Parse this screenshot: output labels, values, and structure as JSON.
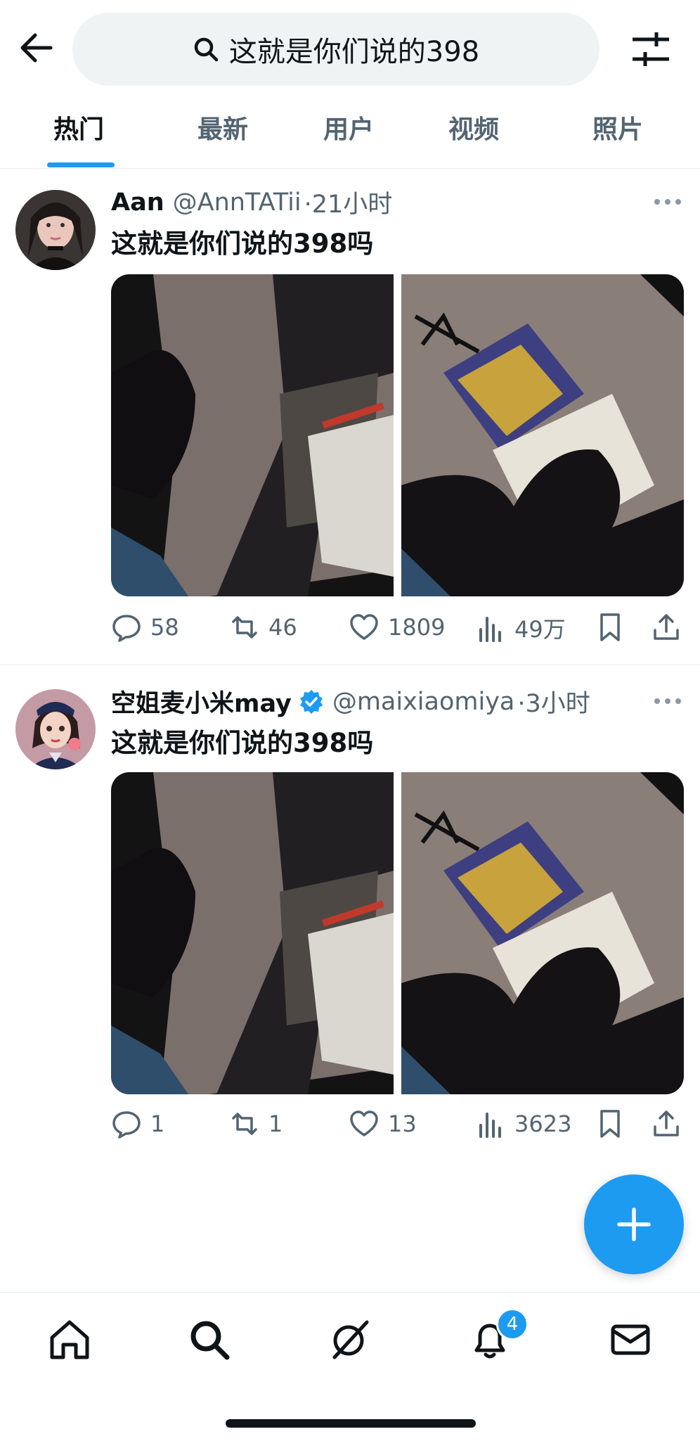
{
  "search": {
    "query": "这就是你们说的398"
  },
  "tabs": [
    {
      "label": "热门",
      "active": true
    },
    {
      "label": "最新"
    },
    {
      "label": "用户"
    },
    {
      "label": "视频"
    },
    {
      "label": "照片"
    }
  ],
  "tweets": [
    {
      "name": "Aan",
      "handle": "@AnnTATii",
      "time": "·21小时",
      "verified": false,
      "text": "这就是你们说的398吗",
      "replies": "58",
      "retweets": "46",
      "likes": "1809",
      "views": "49万"
    },
    {
      "name": "空姐麦小米may",
      "handle": "@maixiaomiya",
      "time": "·3小时",
      "verified": true,
      "text": "这就是你们说的398吗",
      "replies": "1",
      "retweets": "1",
      "likes": "13",
      "views": "3623"
    }
  ],
  "nav": {
    "notifications_badge": "4"
  },
  "colors": {
    "accent": "#1d9bf0",
    "text": "#0f1419",
    "secondary": "#536471"
  }
}
